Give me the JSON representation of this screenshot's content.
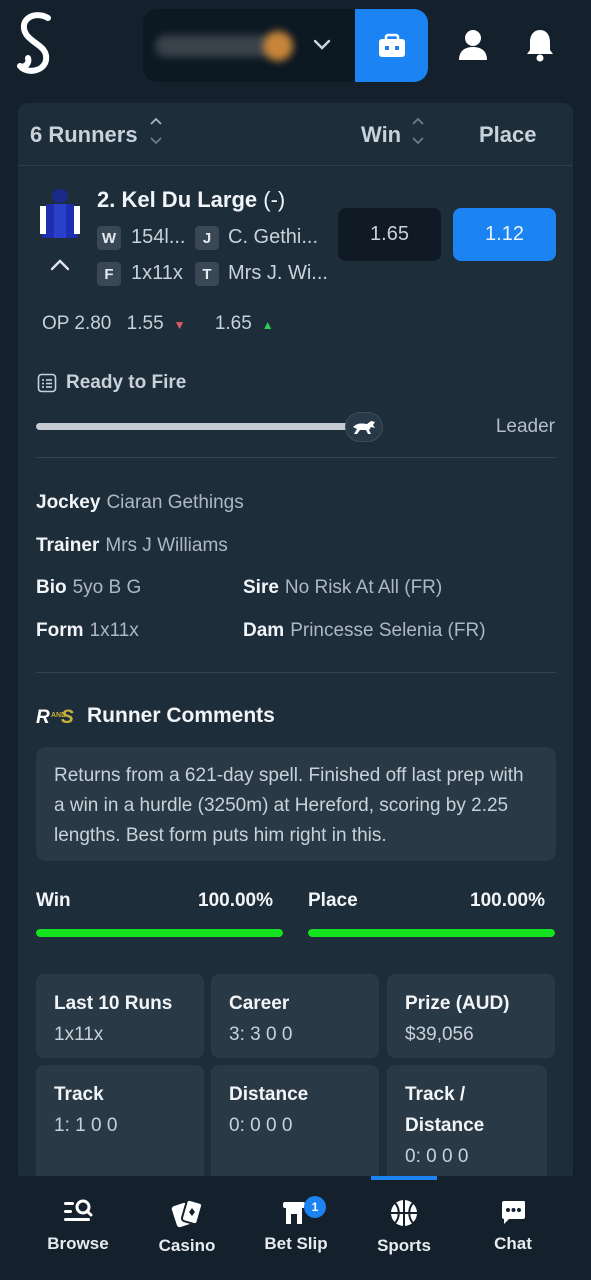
{
  "header": {
    "logo_icon": "stake-s-logo",
    "wallet_icon": "wallet-icon",
    "profile_icon": "user-icon",
    "notifications_icon": "bell-icon",
    "accent": "#1b84f2"
  },
  "runners_table": {
    "runners_label": "6 Runners",
    "win_label": "Win",
    "place_label": "Place"
  },
  "runner": {
    "name": "2. Kel Du Large",
    "suffix": "(-)",
    "weight_tag": "W",
    "weight": "154l...",
    "jockey_tag": "J",
    "jockey_short": "C. Gethi...",
    "form_tag": "F",
    "form_short": "1x11x",
    "trainer_tag": "T",
    "trainer_short": "Mrs J. Wi...",
    "win_odds": "1.65",
    "place_odds": "1.12",
    "fluc_open": "OP 2.80",
    "fluc_mid": "1.55",
    "fluc_last": "1.65"
  },
  "speedmap": {
    "label": "Ready to Fire",
    "position_label": "Leader",
    "position_fraction": 0.62
  },
  "details": {
    "jockey_label": "Jockey",
    "jockey": "Ciaran Gethings",
    "trainer_label": "Trainer",
    "trainer": "Mrs J Williams",
    "bio_label": "Bio",
    "bio": "5yo B G",
    "sire_label": "Sire",
    "sire": "No Risk At All (FR)",
    "form_label": "Form",
    "form": "1x11x",
    "dam_label": "Dam",
    "dam": "Princesse Selenia (FR)"
  },
  "comments": {
    "logo_text": "RNS",
    "title": "Runner Comments",
    "text": "Returns from a 621-day spell. Finished off last prep with a win in a hurdle (3250m) at Hereford, scoring by 2.25 lengths. Best form puts him right in this."
  },
  "percentages": {
    "win_label": "Win",
    "win_value": "100.00%",
    "win_fraction": 1.0,
    "place_label": "Place",
    "place_value": "100.00%",
    "place_fraction": 1.0,
    "bar_color": "#14e21f"
  },
  "stats": [
    {
      "title": "Last 10 Runs",
      "value": "1x11x"
    },
    {
      "title": "Career",
      "value": "3: 3 0 0"
    },
    {
      "title": "Prize (AUD)",
      "value": "$39,056"
    },
    {
      "title": "Track",
      "value": "1: 1 0 0"
    },
    {
      "title": "Distance",
      "value": "0: 0 0 0"
    },
    {
      "title": "Track / Distance",
      "value": "0: 0 0 0"
    }
  ],
  "bottom_nav": {
    "browse": "Browse",
    "casino": "Casino",
    "bet_slip": "Bet Slip",
    "bet_slip_count": "1",
    "sports": "Sports",
    "chat": "Chat",
    "active": "Sports"
  }
}
